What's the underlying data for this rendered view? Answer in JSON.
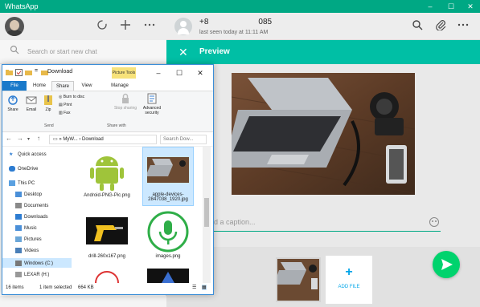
{
  "whatsapp": {
    "window_title": "WhatsApp",
    "window_controls": {
      "minimize": "–",
      "maximize": "☐",
      "close": "✕"
    },
    "search_placeholder": "Search or start new chat",
    "chat": {
      "contact_name": "+8",
      "contact_name_suffix": "085",
      "last_seen": "last seen today at 11:11 AM"
    },
    "header_icons": [
      "refresh-icon",
      "plus-icon",
      "menu-icon"
    ],
    "chat_icons": [
      "search-icon",
      "attach-icon",
      "menu-icon"
    ],
    "preview": {
      "title": "Preview",
      "caption_placeholder": "Add a caption...",
      "add_file_label": "ADD FILE"
    },
    "colors": {
      "accent": "#00bfa5",
      "send": "#00d36d",
      "add_file": "#00a5e8"
    }
  },
  "explorer": {
    "title": "Download",
    "picture_tools": "Picture Tools",
    "window_controls": {
      "minimize": "–",
      "maximize": "☐",
      "close": "✕"
    },
    "tabs": [
      "File",
      "Home",
      "Share",
      "View",
      "Manage"
    ],
    "ribbon": {
      "share": "Share",
      "email": "Email",
      "zip": "Zip",
      "burn": "Burn to disc",
      "print": "Print",
      "fax": "Fax",
      "stop_sharing": "Stop sharing",
      "advanced_security": "Advanced security",
      "group_send": "Send",
      "group_share_with": "Share with"
    },
    "address": {
      "crumb1": "MyW...",
      "crumb2": "Download",
      "search_placeholder": "Search Dow..."
    },
    "nav": [
      {
        "label": "Quick access"
      },
      {
        "label": "OneDrive"
      },
      {
        "label": "This PC"
      },
      {
        "label": "Desktop"
      },
      {
        "label": "Documents"
      },
      {
        "label": "Downloads"
      },
      {
        "label": "Music"
      },
      {
        "label": "Pictures"
      },
      {
        "label": "Videos"
      },
      {
        "label": "Windows (C:)"
      },
      {
        "label": "LEXAR (H:)"
      }
    ],
    "files": [
      {
        "name": "Android-PNG-Pic.png"
      },
      {
        "name": "apple-devices-2847038_1920.jpg"
      },
      {
        "name": "drill-260x167.png"
      },
      {
        "name": "images.png"
      }
    ],
    "status": {
      "items": "16 items",
      "selected": "1 item selected",
      "size": "664 KB"
    }
  }
}
